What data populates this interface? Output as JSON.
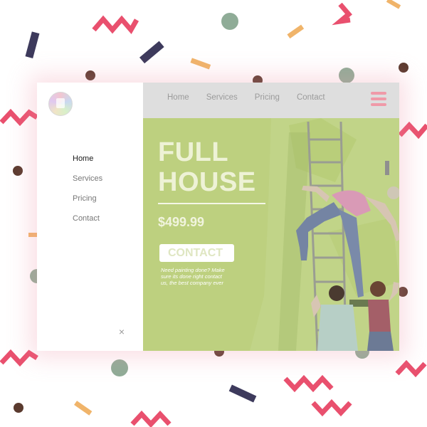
{
  "logo": {
    "icon": "logo-icon"
  },
  "sidebar": {
    "items": [
      {
        "label": "Home",
        "active": true
      },
      {
        "label": "Services",
        "active": false
      },
      {
        "label": "Pricing",
        "active": false
      },
      {
        "label": "Contact",
        "active": false
      }
    ],
    "close_icon": "×"
  },
  "topbar": {
    "items": [
      {
        "label": "Home"
      },
      {
        "label": "Services"
      },
      {
        "label": "Pricing"
      },
      {
        "label": "Contact"
      }
    ],
    "menu_icon": "hamburger-icon"
  },
  "hero": {
    "title_line1": "FULL",
    "title_line2": "HOUSE",
    "price": "$499.99",
    "cta_label": "CONTACT",
    "description": "Need painting done? Make sure its done right contact us, the best company ever"
  },
  "colors": {
    "hero_bg": "#bdd07f",
    "topbar_bg": "#dedede",
    "accent_pink": "#ef9aa8",
    "confetti_pink": "#e9506e",
    "confetti_navy": "#3d3a5c",
    "confetti_sage": "#8fac97",
    "confetti_brown": "#5a3a2e",
    "confetti_orange": "#f0b46a"
  }
}
